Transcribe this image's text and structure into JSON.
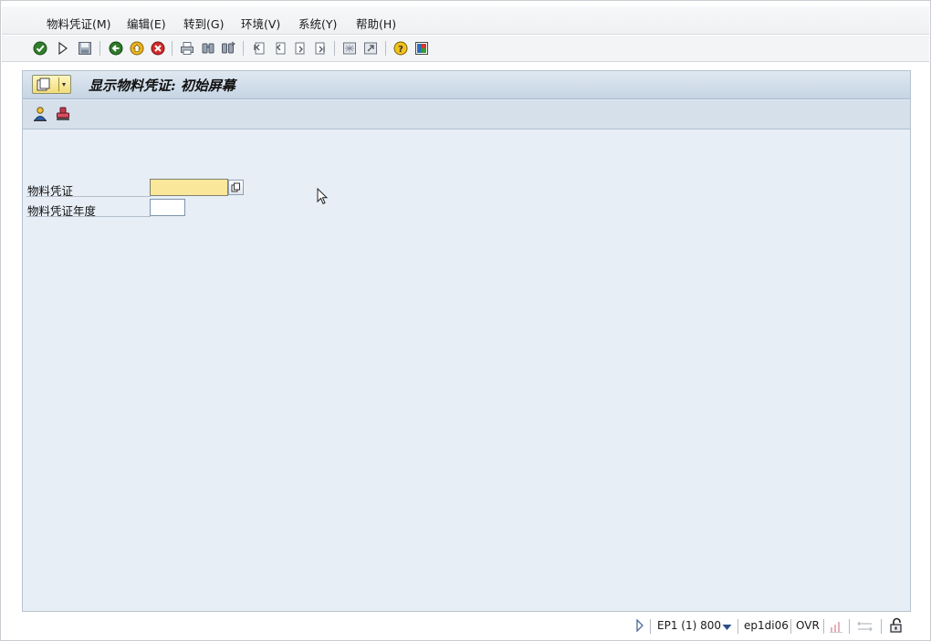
{
  "menu": {
    "items": [
      {
        "label": "物料凭证(M)",
        "key": "M"
      },
      {
        "label": "编辑(E)",
        "key": "E"
      },
      {
        "label": "转到(G)",
        "key": "G"
      },
      {
        "label": "环境(V)",
        "key": "V"
      },
      {
        "label": "系统(Y)",
        "key": "Y"
      },
      {
        "label": "帮助(H)",
        "key": "H"
      }
    ]
  },
  "toolbar": {
    "icons": [
      "enter-icon",
      "command-field-icon",
      "save-icon",
      "back-icon",
      "exit-icon",
      "cancel-icon",
      "print-icon",
      "find-icon",
      "find-next-icon",
      "first-page-icon",
      "previous-page-icon",
      "next-page-icon",
      "last-page-icon",
      "create-session-icon",
      "shortcut-icon",
      "help-icon",
      "customize-layout-icon"
    ]
  },
  "screen": {
    "title": "显示物料凭证: 初始屏幕",
    "app_toolbar_icons": [
      "held-data-icon",
      "stamp-icon"
    ]
  },
  "form": {
    "material_document": {
      "label": "物料凭证",
      "value": ""
    },
    "material_document_year": {
      "label": "物料凭证年度",
      "value": ""
    }
  },
  "status": {
    "system": "EP1 (1) 800",
    "server": "ep1di06",
    "mode": "OVR"
  },
  "colors": {
    "required_field": "#fbe79a",
    "panel_bg": "#e7eef6",
    "title_bar": "#c6d5e4"
  }
}
